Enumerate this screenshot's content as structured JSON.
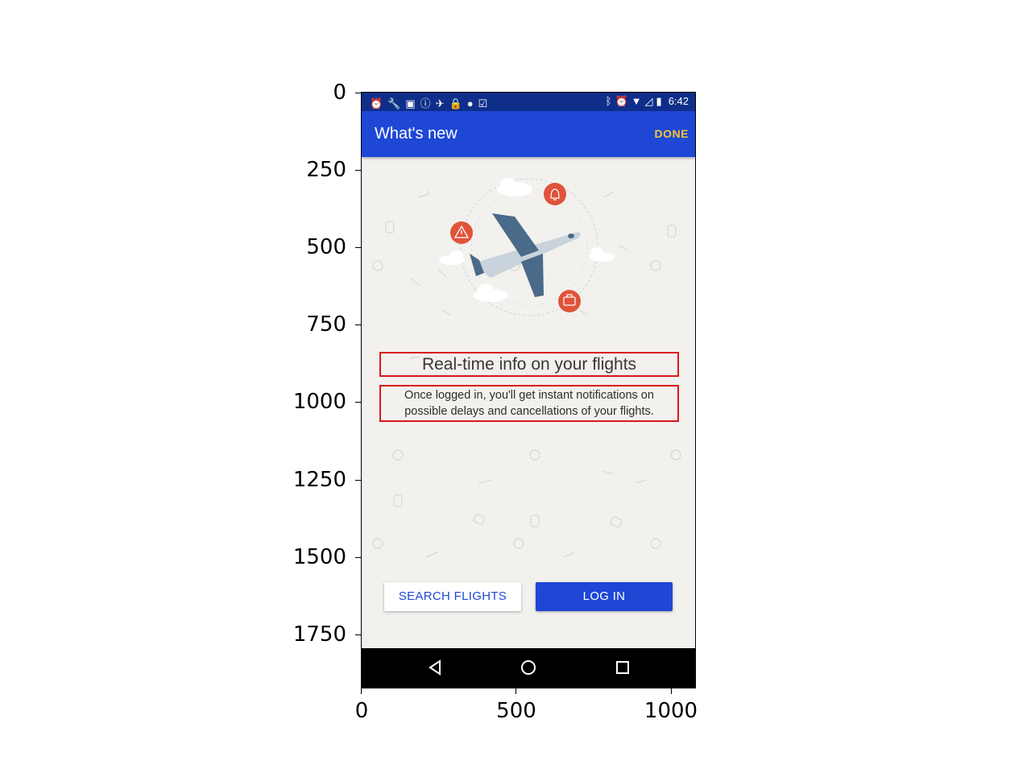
{
  "axes": {
    "y_ticks": [
      "0",
      "250",
      "500",
      "750",
      "1000",
      "1250",
      "1500",
      "1750"
    ],
    "x_ticks": [
      "0",
      "500",
      "1000"
    ]
  },
  "status_bar": {
    "time": "6:42",
    "left_icons": [
      "alarm-icon",
      "wrench-icon",
      "facebook-icon",
      "info-icon",
      "satellite-icon",
      "lock-icon",
      "android-icon",
      "clipboard-check-icon"
    ],
    "right_icons": [
      "bluetooth-icon",
      "alarm-icon",
      "wifi-icon",
      "no-signal-icon",
      "battery-icon"
    ]
  },
  "app_bar": {
    "title": "What's new",
    "done_label": "DONE"
  },
  "content": {
    "headline": "Real-time info on your flights",
    "body_line1": "Once logged in, you'll get instant notifications on",
    "body_line2": "possible delays and cancellations of your flights."
  },
  "buttons": {
    "search_flights": "SEARCH FLIGHTS",
    "log_in": "LOG IN"
  },
  "colors": {
    "status_bar": "#0f2e8a",
    "app_bar": "#1e47d6",
    "done_accent": "#f7c531",
    "badge": "#e0533a",
    "highlight_box": "#d9191a",
    "background": "#f2f1ee"
  }
}
